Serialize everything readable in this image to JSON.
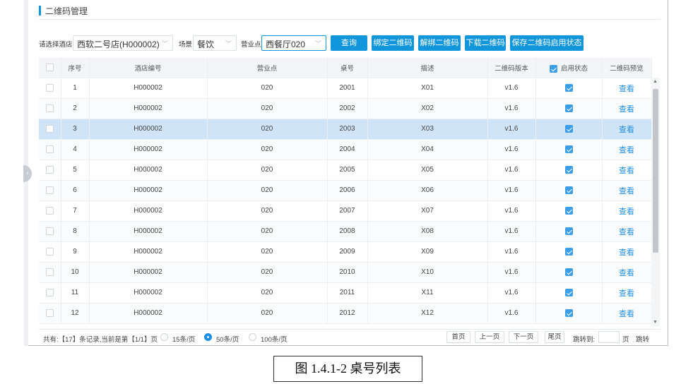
{
  "page_title": "二维码管理",
  "filters": {
    "hotel_label": "请选择酒店",
    "hotel_value": "西软二号店(H000002)",
    "scene_label": "场景",
    "scene_value": "餐饮",
    "outlet_label": "营业点",
    "outlet_value": "西餐厅020"
  },
  "actions": {
    "query": "查询",
    "bind": "绑定二维码",
    "unbind": "解绑二维码",
    "download": "下载二维码",
    "save_status": "保存二维码启用状态"
  },
  "table": {
    "columns": [
      "序号",
      "酒店编号",
      "营业点",
      "桌号",
      "描述",
      "二维码版本",
      "启用状态",
      "二维码预览"
    ],
    "header_status_checked": true,
    "selected_row_index": 2,
    "rows": [
      {
        "no": "1",
        "hotel": "H000002",
        "outlet": "020",
        "table": "2001",
        "desc": "X01",
        "version": "v1.6",
        "enabled": true,
        "preview": "查看"
      },
      {
        "no": "2",
        "hotel": "H000002",
        "outlet": "020",
        "table": "2002",
        "desc": "X02",
        "version": "v1.6",
        "enabled": true,
        "preview": "查看"
      },
      {
        "no": "3",
        "hotel": "H000002",
        "outlet": "020",
        "table": "2003",
        "desc": "X03",
        "version": "v1.6",
        "enabled": true,
        "preview": "查看"
      },
      {
        "no": "4",
        "hotel": "H000002",
        "outlet": "020",
        "table": "2004",
        "desc": "X04",
        "version": "v1.6",
        "enabled": true,
        "preview": "查看"
      },
      {
        "no": "5",
        "hotel": "H000002",
        "outlet": "020",
        "table": "2005",
        "desc": "X05",
        "version": "v1.6",
        "enabled": true,
        "preview": "查看"
      },
      {
        "no": "6",
        "hotel": "H000002",
        "outlet": "020",
        "table": "2006",
        "desc": "X06",
        "version": "v1.6",
        "enabled": true,
        "preview": "查看"
      },
      {
        "no": "7",
        "hotel": "H000002",
        "outlet": "020",
        "table": "2007",
        "desc": "X07",
        "version": "v1.6",
        "enabled": true,
        "preview": "查看"
      },
      {
        "no": "8",
        "hotel": "H000002",
        "outlet": "020",
        "table": "2008",
        "desc": "X08",
        "version": "v1.6",
        "enabled": true,
        "preview": "查看"
      },
      {
        "no": "9",
        "hotel": "H000002",
        "outlet": "020",
        "table": "2009",
        "desc": "X09",
        "version": "v1.6",
        "enabled": true,
        "preview": "查看"
      },
      {
        "no": "10",
        "hotel": "H000002",
        "outlet": "020",
        "table": "2010",
        "desc": "X10",
        "version": "v1.6",
        "enabled": true,
        "preview": "查看"
      },
      {
        "no": "11",
        "hotel": "H000002",
        "outlet": "020",
        "table": "2011",
        "desc": "X11",
        "version": "v1.6",
        "enabled": true,
        "preview": "查看"
      },
      {
        "no": "12",
        "hotel": "H000002",
        "outlet": "020",
        "table": "2012",
        "desc": "X12",
        "version": "v1.6",
        "enabled": true,
        "preview": "查看"
      }
    ]
  },
  "pagination": {
    "summary": "共有:【17】条记录,当前是第【1/1】页",
    "size_options": [
      "15条/页",
      "50条/页",
      "100条/页"
    ],
    "selected_size": "50条/页",
    "first": "首页",
    "prev": "上一页",
    "next": "下一页",
    "last": "尾页",
    "jump_label": "跳转到:",
    "page_unit": "页",
    "jump_button": "跳转"
  },
  "caption": "图 1.4.1-2  桌号列表",
  "colors": {
    "accent": "#1296db",
    "selected_row": "#cfe4f7",
    "checkbox_on": "#3d9ee8",
    "link": "#1e8fe0"
  },
  "icons": {
    "dropdown": "chevron-down-icon",
    "collapse": "chevron-left-icon",
    "checkbox": "checkbox-icon",
    "radio": "radio-icon"
  }
}
